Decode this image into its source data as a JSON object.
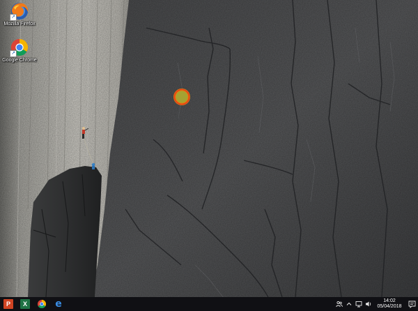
{
  "desktop": {
    "icons": [
      {
        "label": "Mozilla Firefox",
        "icon": "firefox-icon"
      },
      {
        "label": "Google Chrome",
        "icon": "chrome-icon"
      }
    ],
    "click_marker_color": "#ff8c00"
  },
  "taskbar": {
    "pinned_apps": [
      {
        "name": "PowerPoint",
        "letter": "P",
        "color": "#d04423"
      },
      {
        "name": "Excel",
        "letter": "X",
        "color": "#1f7244"
      },
      {
        "name": "Google Chrome",
        "icon": "chrome-icon"
      },
      {
        "name": "Microsoft Edge",
        "letter": "e",
        "color": "#1b72d0"
      }
    ],
    "tray": {
      "icons": [
        "people-icon",
        "chevron-up-icon",
        "network-icon",
        "volume-icon"
      ],
      "time": "14:02",
      "date": "05/04/2018"
    }
  }
}
